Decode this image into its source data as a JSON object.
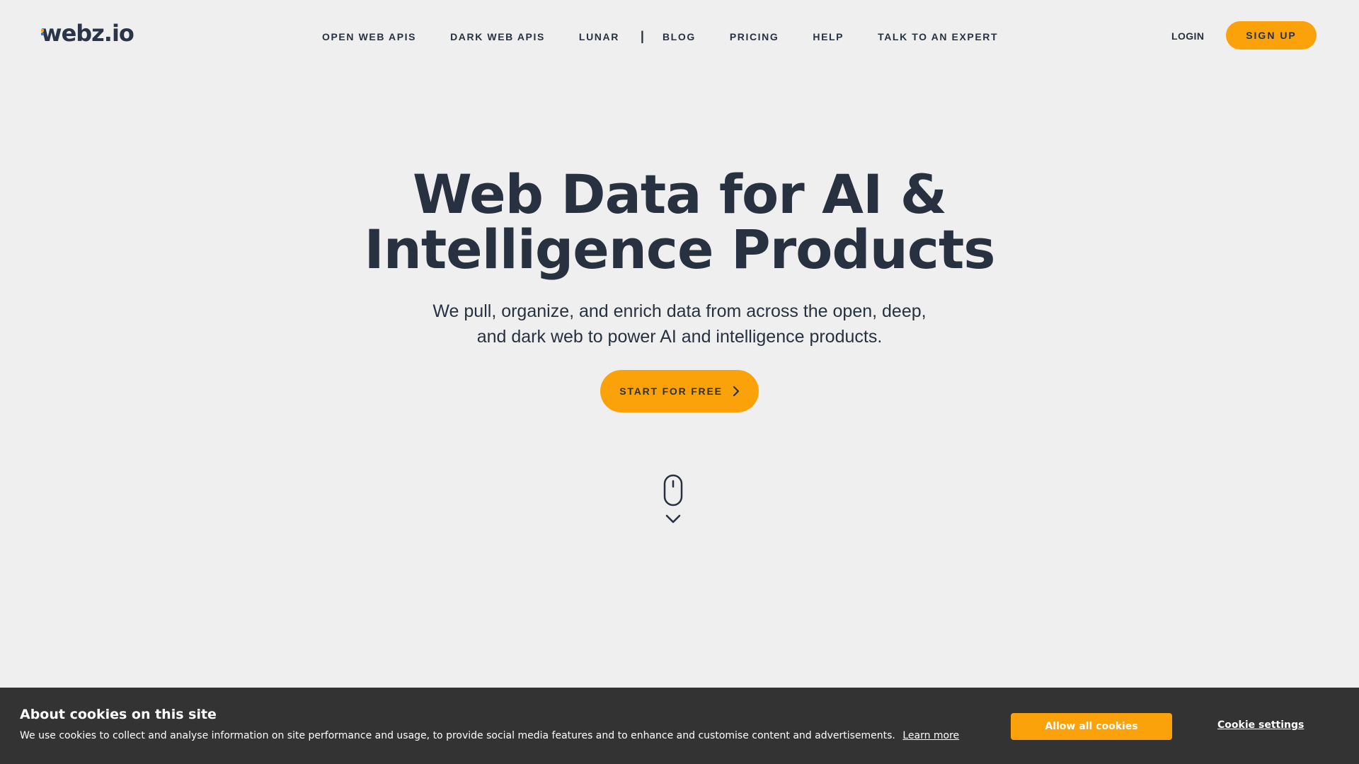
{
  "header": {
    "logo_text": "webz.io",
    "nav_items": [
      {
        "label": "OPEN WEB APIS"
      },
      {
        "label": "DARK WEB APIS"
      },
      {
        "label": "LUNAR"
      },
      {
        "label": "BLOG"
      },
      {
        "label": "PRICING"
      },
      {
        "label": "HELP"
      },
      {
        "label": "TALK TO AN EXPERT"
      }
    ],
    "nav_separator": "|",
    "login_label": "LOGIN",
    "signup_label": "SIGN UP"
  },
  "hero": {
    "title_line1": "Web Data for AI &",
    "title_line2": "Intelligence Products",
    "subtitle_line1": "We pull, organize, and enrich data from across the open, deep,",
    "subtitle_line2": "and dark web to power AI and intelligence products.",
    "cta_label": "START FOR FREE",
    "scroll_icon": "mouse-icon",
    "scroll_chevron_icon": "chevron-down-icon"
  },
  "cookie_banner": {
    "title": "About cookies on this site",
    "text": "We use cookies to collect and analyse information on site performance and usage, to provide social media features and to enhance and customise content and advertisements.",
    "learn_more_label": "Learn more",
    "allow_label": "Allow all cookies",
    "settings_label": "Cookie settings"
  },
  "colors": {
    "background": "#efefef",
    "accent": "#fba20b",
    "text_dark": "#27313f",
    "banner_bg": "#333333"
  }
}
